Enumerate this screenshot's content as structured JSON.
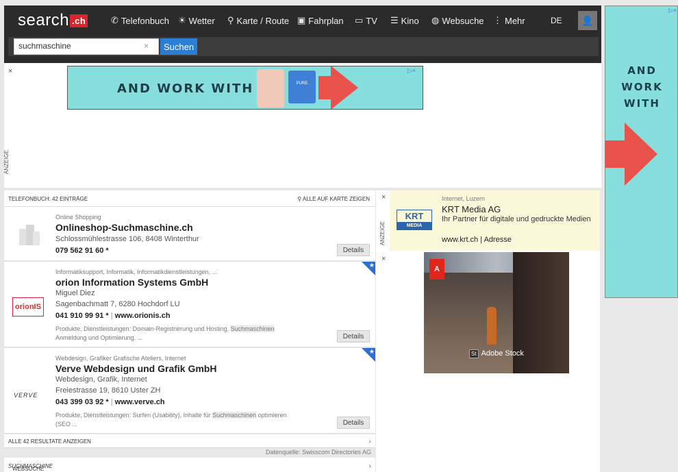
{
  "header": {
    "logo_text": "search",
    "logo_badge": ".ch",
    "nav": [
      {
        "icon": "phone-icon",
        "label": "Telefonbuch"
      },
      {
        "icon": "weather-icon",
        "label": "Wetter"
      },
      {
        "icon": "map-pin-icon",
        "label": "Karte / Route"
      },
      {
        "icon": "train-icon",
        "label": "Fahrplan"
      },
      {
        "icon": "tv-icon",
        "label": "TV"
      },
      {
        "icon": "cinema-icon",
        "label": "Kino"
      },
      {
        "icon": "globe-icon",
        "label": "Websuche"
      },
      {
        "icon": "more-icon",
        "label": "Mehr"
      }
    ],
    "lang": "DE",
    "search_value": "suchmaschine",
    "search_clear": "×",
    "search_button": "Suchen"
  },
  "ads": {
    "close": "×",
    "label": "ANZEIGE",
    "banner_text": "AND WORK WITH",
    "adchoices": "▷×",
    "sky_text": [
      "AND",
      "WORK",
      "WITH"
    ],
    "fire_label": "PURE",
    "accent_color": "#86dfdd",
    "arrow_color": "#e8524a"
  },
  "telefonbuch": {
    "title": "TELEFONBUCH: 42 EINTRÄGE",
    "map_link": "ALLE AUF KARTE ZEIGEN",
    "entries": [
      {
        "category": "Online Shopping",
        "name": "Onlineshop-Suchmaschine.ch",
        "address": "Schlossmühlestrasse 106, 8408 Winterthur",
        "phone": "079 562 91 60 *",
        "details": "Details"
      },
      {
        "category": "Informatiksupport, Informatik, Informatikdienstleistungen, ...",
        "name": "orion Information Systems GmbH",
        "person": "Miguel Diez",
        "address": "Sagenbachmatt 7, 6280 Hochdorf LU",
        "phone": "041 910 99 91 *",
        "web": "www.orionis.ch",
        "desc1": "Produkte, Dienstleistungen: Domain-Registrierung und Hosting, ",
        "desc_hl": "Suchmaschinen",
        "desc2": "Anmeldung und Optimierung, ...",
        "logo": "orionIS",
        "details": "Details"
      },
      {
        "category": "Webdesign, Grafiker Grafische Ateliers, Internet",
        "name": "Verve Webdesign und Grafik GmbH",
        "person": "Webdesign, Grafik, Internet",
        "address": "Freiestrasse 19, 8610 Uster ZH",
        "phone": "043 399 03 92 *",
        "web": "www.verve.ch",
        "desc1": "Produkte, Dienstleistungen: Surfen (Usability), Inhalte für ",
        "desc_hl": "Suchmaschinen",
        "desc2": " optimieren",
        "desc3": "(SEO ...",
        "logo": "VERVE",
        "details": "Details"
      }
    ],
    "all_results": "ALLE 42 RESULTATE ANZEIGEN",
    "source": "Datenquelle: Swisscom Directories AG",
    "websuche_prefix": "WEBSUCHE FÜR ",
    "websuche_term": "SUCHMASCHINE",
    "separator": "|"
  },
  "krt_ad": {
    "close": "×",
    "label": "ANZEIGE",
    "logo_top": "KRT",
    "logo_bottom": "MEDIA",
    "category": "Internet, Luzern",
    "name": "KRT Media AG",
    "desc": "Ihr Partner für digitale und gedruckte Medien",
    "web": "www.krt.ch",
    "sep": "|",
    "address": "Adresse"
  },
  "adobe_ad": {
    "close": "×",
    "logo": "A",
    "logo_sub": "Adobe",
    "badge": "St",
    "text": "Adobe Stock"
  }
}
